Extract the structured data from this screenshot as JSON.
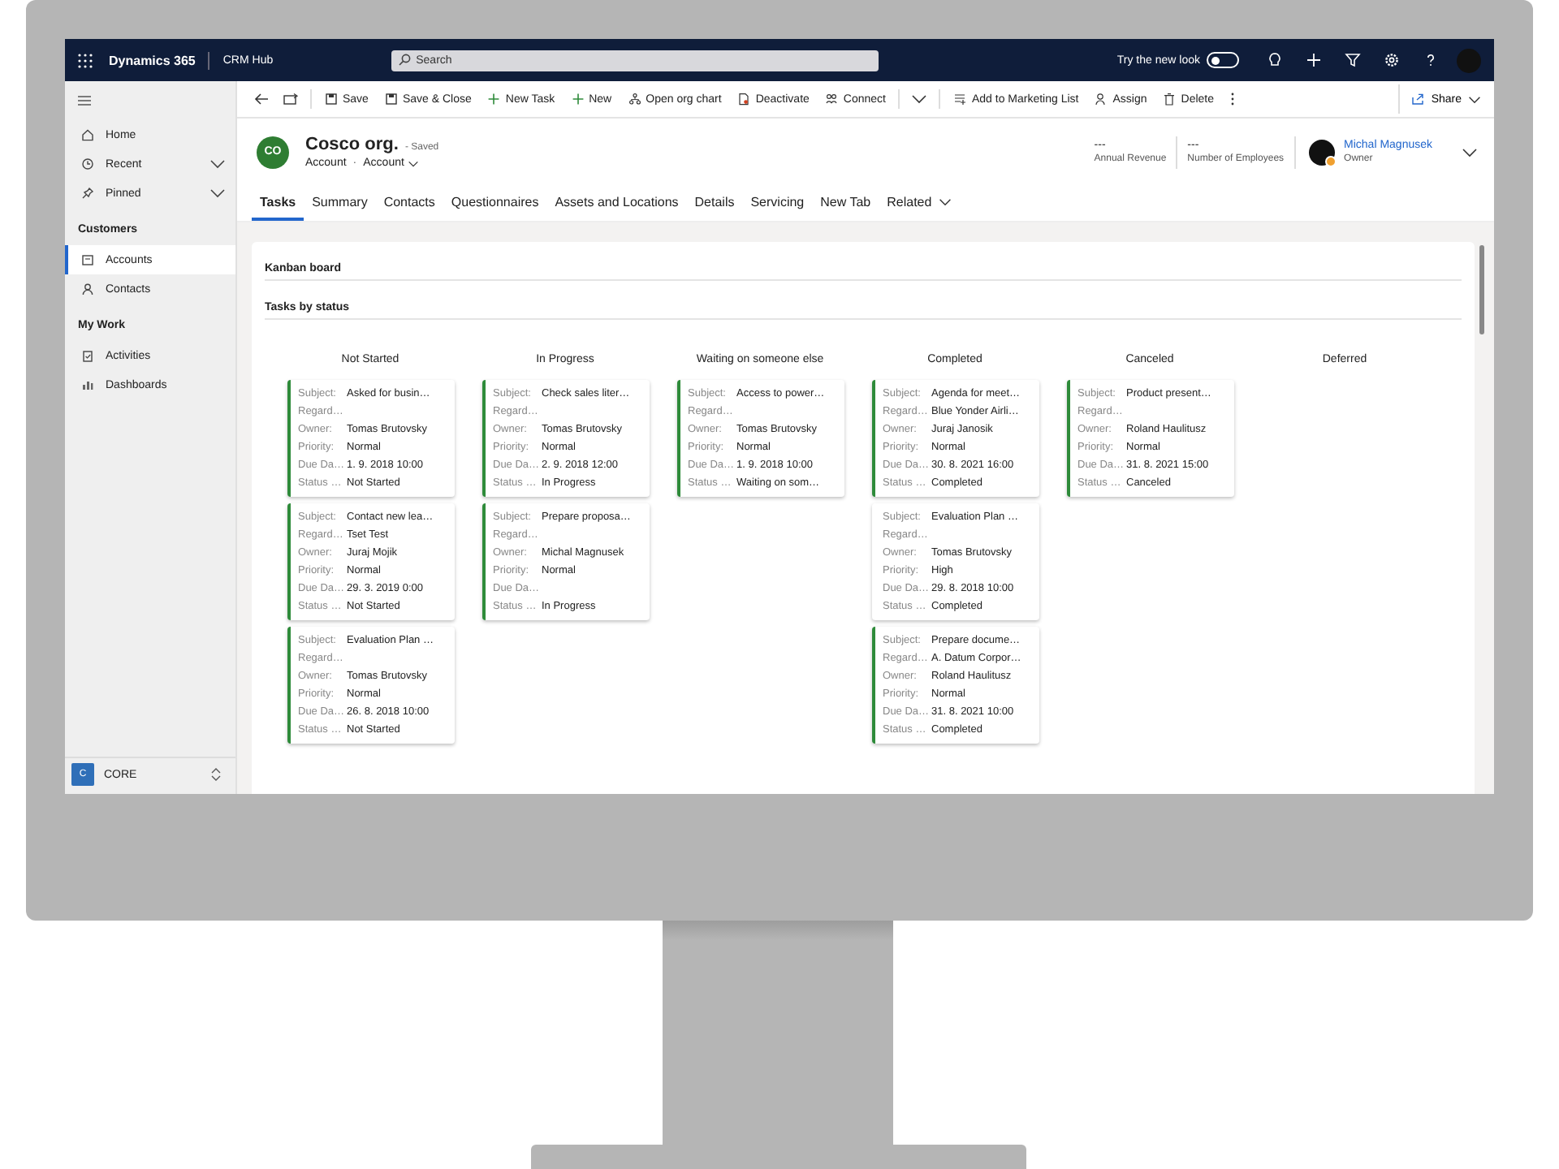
{
  "top_bar": {
    "app_name": "Dynamics 365",
    "area": "CRM Hub",
    "search": {
      "placeholder": "Search"
    },
    "new_look": {
      "label": "Try the new look",
      "on": false
    }
  },
  "sidebar": {
    "top_items": [
      {
        "label": "Home",
        "expandable": false
      },
      {
        "label": "Recent",
        "expandable": true
      },
      {
        "label": "Pinned",
        "expandable": true
      }
    ],
    "groups": [
      {
        "title": "Customers",
        "items": [
          {
            "label": "Accounts",
            "selected": true
          },
          {
            "label": "Contacts",
            "selected": false
          }
        ]
      },
      {
        "title": "My Work",
        "items": [
          {
            "label": "Activities",
            "selected": false
          },
          {
            "label": "Dashboards",
            "selected": false
          }
        ]
      }
    ],
    "area_switcher": {
      "badge": "C",
      "label": "CORE"
    }
  },
  "command_bar": {
    "items": [
      "Save",
      "Save & Close",
      "New Task",
      "New",
      "Open org chart",
      "Deactivate",
      "Connect",
      "Add to Marketing List",
      "Assign",
      "Delete"
    ],
    "share": "Share"
  },
  "record": {
    "initials": "CO",
    "name": "Cosco org.",
    "saved": "- Saved",
    "entity": "Account",
    "separator": "·",
    "form": "Account",
    "fields": [
      {
        "value": "---",
        "label": "Annual Revenue"
      },
      {
        "value": "---",
        "label": "Number of Employees"
      }
    ],
    "owner": {
      "name": "Michal Magnusek",
      "label": "Owner"
    }
  },
  "tabs": [
    {
      "label": "Tasks",
      "selected": true
    },
    {
      "label": "Summary",
      "selected": false
    },
    {
      "label": "Contacts",
      "selected": false
    },
    {
      "label": "Questionnaires",
      "selected": false
    },
    {
      "label": "Assets and Locations",
      "selected": false
    },
    {
      "label": "Details",
      "selected": false
    },
    {
      "label": "Servicing",
      "selected": false
    },
    {
      "label": "New Tab",
      "selected": false
    },
    {
      "label": "Related",
      "selected": false
    }
  ],
  "sections": [
    "Kanban board",
    "Tasks by status"
  ],
  "kanban": [
    {
      "title": "Not Started",
      "cards": [
        {
          "accent": true,
          "fields": [
            {
              "label": "Subject:",
              "value": "Asked for busin…"
            },
            {
              "label": "Regard…"
            },
            {
              "label": "Owner:",
              "value": "Tomas Brutovsky"
            },
            {
              "label": "Priority:",
              "value": "Normal"
            },
            {
              "label": "Due Da…",
              "value": "1. 9. 2018 10:00"
            },
            {
              "label": "Status …",
              "value": "Not Started"
            }
          ]
        },
        {
          "accent": true,
          "fields": [
            {
              "label": "Subject:",
              "value": "Contact new lea…"
            },
            {
              "label": "Regard…",
              "value": "Tset Test"
            },
            {
              "label": "Owner:",
              "value": "Juraj Mojik"
            },
            {
              "label": "Priority:",
              "value": "Normal"
            },
            {
              "label": "Due Da…",
              "value": "29. 3. 2019 0:00"
            },
            {
              "label": "Status …",
              "value": "Not Started"
            }
          ]
        },
        {
          "accent": true,
          "fields": [
            {
              "label": "Subject:",
              "value": "Evaluation Plan …"
            },
            {
              "label": "Regard…"
            },
            {
              "label": "Owner:",
              "value": "Tomas Brutovsky"
            },
            {
              "label": "Priority:",
              "value": "Normal"
            },
            {
              "label": "Due Da…",
              "value": "26. 8. 2018 10:00"
            },
            {
              "label": "Status …",
              "value": "Not Started"
            }
          ]
        }
      ]
    },
    {
      "title": "In Progress",
      "cards": [
        {
          "accent": true,
          "fields": [
            {
              "label": "Subject:",
              "value": "Check sales liter…"
            },
            {
              "label": "Regard…"
            },
            {
              "label": "Owner:",
              "value": "Tomas Brutovsky"
            },
            {
              "label": "Priority:",
              "value": "Normal"
            },
            {
              "label": "Due Da…",
              "value": "2. 9. 2018 12:00"
            },
            {
              "label": "Status …",
              "value": "In Progress"
            }
          ]
        },
        {
          "accent": true,
          "fields": [
            {
              "label": "Subject:",
              "value": "Prepare proposa…"
            },
            {
              "label": "Regard…"
            },
            {
              "label": "Owner:",
              "value": "Michal Magnusek"
            },
            {
              "label": "Priority:",
              "value": "Normal"
            },
            {
              "label": "Due Da…"
            },
            {
              "label": "Status …",
              "value": "In Progress"
            }
          ]
        }
      ]
    },
    {
      "title": "Waiting on someone else",
      "cards": [
        {
          "accent": true,
          "fields": [
            {
              "label": "Subject:",
              "value": "Access to power…"
            },
            {
              "label": "Regard…"
            },
            {
              "label": "Owner:",
              "value": "Tomas Brutovsky"
            },
            {
              "label": "Priority:",
              "value": "Normal"
            },
            {
              "label": "Due Da…",
              "value": "1. 9. 2018 10:00"
            },
            {
              "label": "Status …",
              "value": "Waiting on som…"
            }
          ]
        }
      ]
    },
    {
      "title": "Completed",
      "cards": [
        {
          "accent": true,
          "fields": [
            {
              "label": "Subject:",
              "value": "Agenda for meet…"
            },
            {
              "label": "Regard…",
              "value": "Blue Yonder Airli…"
            },
            {
              "label": "Owner:",
              "value": "Juraj Janosik"
            },
            {
              "label": "Priority:",
              "value": "Normal"
            },
            {
              "label": "Due Da…",
              "value": "30. 8. 2021 16:00"
            },
            {
              "label": "Status …",
              "value": "Completed"
            }
          ]
        },
        {
          "accent": false,
          "fields": [
            {
              "label": "Subject:",
              "value": "Evaluation Plan …"
            },
            {
              "label": "Regard…"
            },
            {
              "label": "Owner:",
              "value": "Tomas Brutovsky"
            },
            {
              "label": "Priority:",
              "value": "High"
            },
            {
              "label": "Due Da…",
              "value": "29. 8. 2018 10:00"
            },
            {
              "label": "Status …",
              "value": "Completed"
            }
          ]
        },
        {
          "accent": true,
          "fields": [
            {
              "label": "Subject:",
              "value": "Prepare docume…"
            },
            {
              "label": "Regard…",
              "value": "A. Datum Corpor…"
            },
            {
              "label": "Owner:",
              "value": "Roland Haulitusz"
            },
            {
              "label": "Priority:",
              "value": "Normal"
            },
            {
              "label": "Due Da…",
              "value": "31. 8. 2021 10:00"
            },
            {
              "label": "Status …",
              "value": "Completed"
            }
          ]
        }
      ]
    },
    {
      "title": "Canceled",
      "cards": [
        {
          "accent": true,
          "fields": [
            {
              "label": "Subject:",
              "value": "Product present…"
            },
            {
              "label": "Regard…"
            },
            {
              "label": "Owner:",
              "value": "Roland Haulitusz"
            },
            {
              "label": "Priority:",
              "value": "Normal"
            },
            {
              "label": "Due Da…",
              "value": "31. 8. 2021 15:00"
            },
            {
              "label": "Status …",
              "value": "Canceled"
            }
          ]
        }
      ]
    },
    {
      "title": "Deferred"
    }
  ]
}
